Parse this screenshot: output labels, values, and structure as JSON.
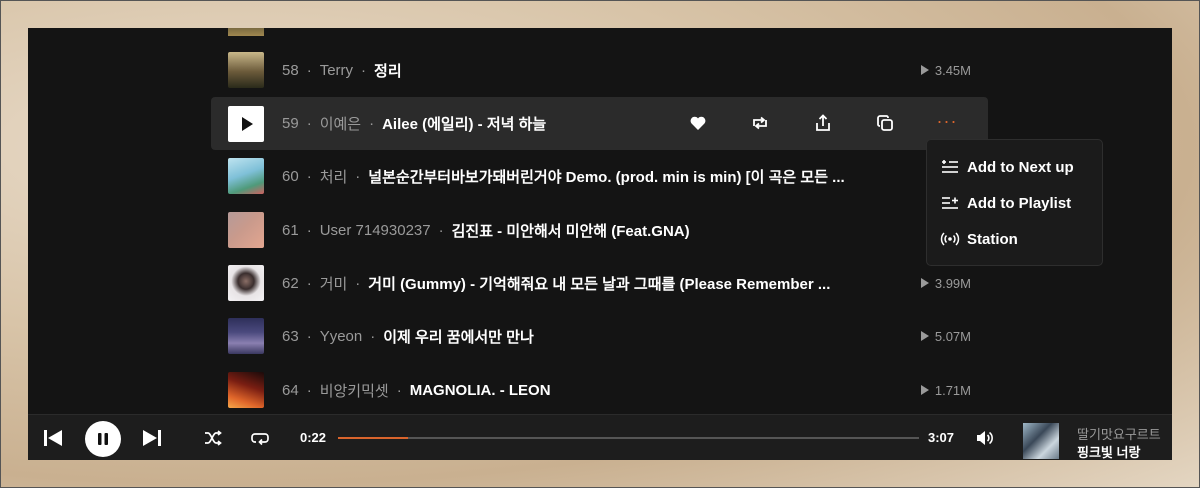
{
  "colors": {
    "accent": "#d9642c",
    "panel_bg": "#141414",
    "row_hover_bg": "#2b2b2b",
    "muted_text": "#9a9a9a"
  },
  "tracks": [
    {
      "number": "58",
      "artist": "Terry",
      "title": "정리",
      "plays": "3.45M"
    },
    {
      "number": "59",
      "artist": "이예은",
      "title": "Ailee (에일리) - 저녁 하늘",
      "plays": ""
    },
    {
      "number": "60",
      "artist": "처리",
      "title": "널본순간부터바보가돼버린거야 Demo. (prod. min is min) [이 곡은 모든 ...",
      "plays": ""
    },
    {
      "number": "61",
      "artist": "User 714930237",
      "title": "김진표 - 미안해서 미안해 (Feat.GNA)",
      "plays": ""
    },
    {
      "number": "62",
      "artist": "거미",
      "title": "거미 (Gummy) - 기억해줘요 내 모든 날과 그때를 (Please Remember ...",
      "plays": "3.99M"
    },
    {
      "number": "63",
      "artist": "Yyeon",
      "title": "이제 우리 꿈에서만 만나",
      "plays": "5.07M"
    },
    {
      "number": "64",
      "artist": "비앙키믹셋",
      "title": "MAGNOLIA. - LEON",
      "plays": "1.71M"
    }
  ],
  "separator": "·",
  "row_actions": [
    "heart-icon",
    "repost-icon",
    "share-icon",
    "copy-icon",
    "more-icon"
  ],
  "more_label": "···",
  "context_menu": {
    "items": [
      {
        "label": "Add to Next up",
        "icon": "next-up-icon"
      },
      {
        "label": "Add to Playlist",
        "icon": "add-playlist-icon"
      },
      {
        "label": "Station",
        "icon": "station-icon"
      }
    ]
  },
  "player": {
    "elapsed": "0:22",
    "duration": "3:07",
    "progress": 0.12,
    "now_playing_artist": "딸기맛요구르트",
    "now_playing_title": "핑크빛 너랑"
  }
}
